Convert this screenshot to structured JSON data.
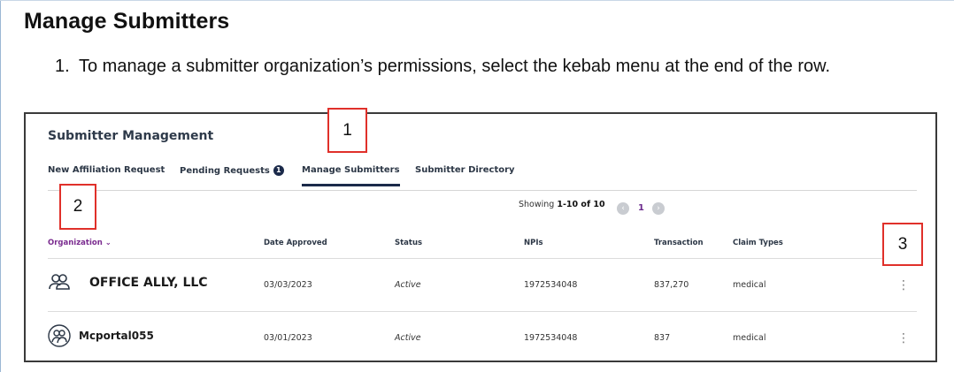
{
  "heading": "Manage Submitters",
  "instruction": {
    "number": "1.",
    "text": "To manage a submitter organization’s permissions, select the kebab menu at the end of the row."
  },
  "panel": {
    "title": "Submitter Management",
    "tabs": [
      {
        "label": "New Affiliation Request"
      },
      {
        "label": "Pending Requests",
        "badge": "1"
      },
      {
        "label": "Manage Submitters",
        "active": true
      },
      {
        "label": "Submitter Directory"
      }
    ],
    "showing_prefix": "Showing ",
    "showing_range": "1-10 of 10",
    "page_number": "1",
    "columns": [
      "Organization",
      "Date Approved",
      "Status",
      "NPIs",
      "Transaction",
      "Claim Types"
    ],
    "rows": [
      {
        "organization": "OFFICE ALLY, LLC",
        "date_approved": "03/03/2023",
        "status": "Active",
        "npis": "1972534048",
        "transaction": "837,270",
        "claim_types": "medical",
        "kebab": "⋮"
      },
      {
        "organization": "Mcportal055",
        "date_approved": "03/01/2023",
        "status": "Active",
        "npis": "1972534048",
        "transaction": "837",
        "claim_types": "medical",
        "kebab": "⋮"
      }
    ]
  },
  "callouts": [
    "1",
    "2",
    "3"
  ],
  "icons": {
    "users": "users-icon",
    "chevron": "chevron-down-icon",
    "prev": "chevron-left-icon",
    "next": "chevron-right-icon"
  }
}
